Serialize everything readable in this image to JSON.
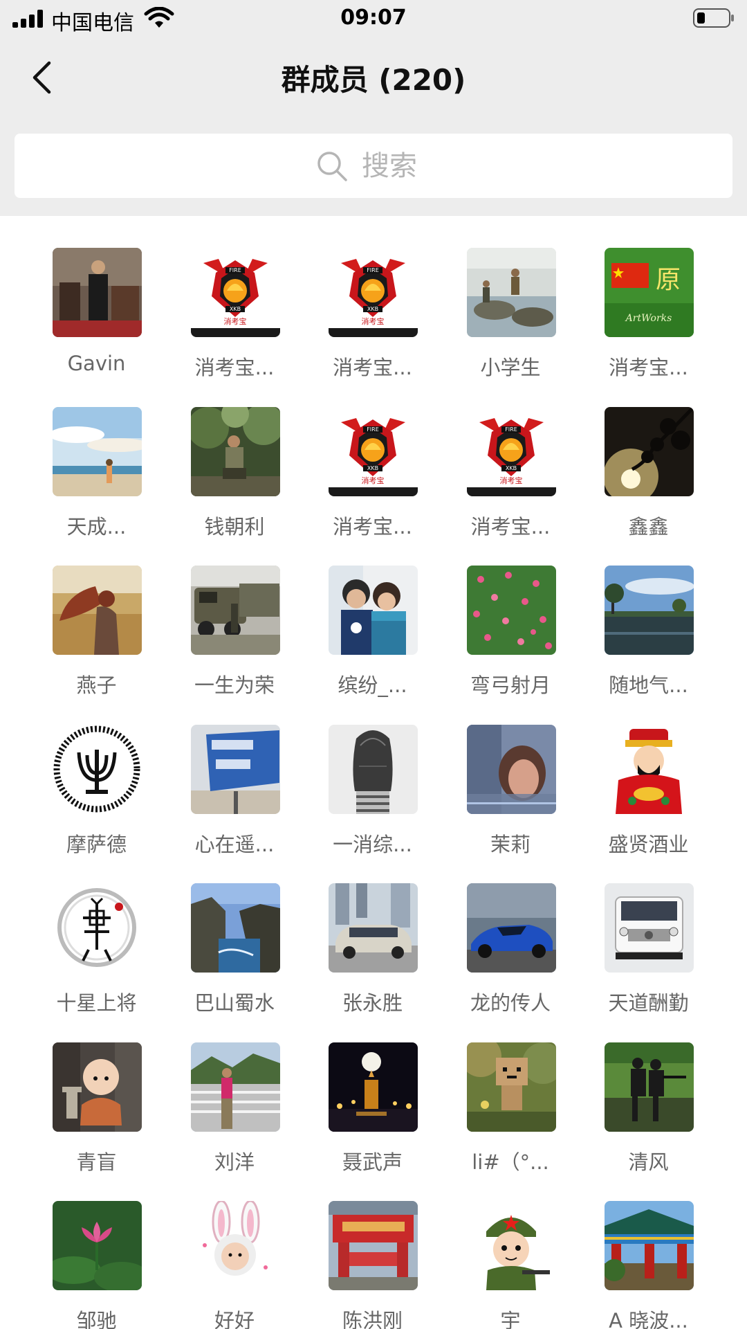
{
  "status_bar": {
    "carrier": "中国电信",
    "time": "09:07"
  },
  "header": {
    "back_icon": "chevron-left-icon",
    "title": "群成员 (220)"
  },
  "search": {
    "icon": "search-icon",
    "placeholder": "搜索"
  },
  "members": [
    {
      "name": "Gavin",
      "avatar": "photo-man-dark"
    },
    {
      "name": "消考宝...",
      "avatar": "fire-xkb-logo"
    },
    {
      "name": "消考宝...",
      "avatar": "fire-xkb-logo"
    },
    {
      "name": "小学生",
      "avatar": "photo-river-rocks"
    },
    {
      "name": "消考宝...",
      "avatar": "flag-grass"
    },
    {
      "name": "天成...",
      "avatar": "photo-beach-sky"
    },
    {
      "name": "钱朝利",
      "avatar": "photo-forest-man"
    },
    {
      "name": "消考宝...",
      "avatar": "fire-xkb-logo"
    },
    {
      "name": "消考宝...",
      "avatar": "fire-xkb-logo"
    },
    {
      "name": "鑫鑫",
      "avatar": "photo-silhouette-branch"
    },
    {
      "name": "燕子",
      "avatar": "photo-wheat-girl"
    },
    {
      "name": "一生为荣",
      "avatar": "photo-military-vehicle"
    },
    {
      "name": "缤纷_...",
      "avatar": "photo-couple"
    },
    {
      "name": "弯弓射月",
      "avatar": "photo-pink-flowers"
    },
    {
      "name": "随地气...",
      "avatar": "photo-lake-trees"
    },
    {
      "name": "摩萨德",
      "avatar": "emblem-menorah"
    },
    {
      "name": "心在遥...",
      "avatar": "photo-road-sign"
    },
    {
      "name": "一消综...",
      "avatar": "sketch-girl"
    },
    {
      "name": "茉莉",
      "avatar": "photo-blurred-woman"
    },
    {
      "name": "盛贤酒业",
      "avatar": "cartoon-fortune-god"
    },
    {
      "name": "十星上将",
      "avatar": "ink-tribal-figure"
    },
    {
      "name": "巴山蜀水",
      "avatar": "photo-coast-cliffs"
    },
    {
      "name": "张永胜",
      "avatar": "photo-silver-car"
    },
    {
      "name": "龙的传人",
      "avatar": "photo-blue-sportscar"
    },
    {
      "name": "天道酬勤",
      "avatar": "photo-white-suv"
    },
    {
      "name": "青盲",
      "avatar": "cartoon-monk"
    },
    {
      "name": "刘洋",
      "avatar": "photo-man-bridge"
    },
    {
      "name": "聂武声",
      "avatar": "photo-night-moon"
    },
    {
      "name": "li#（°...",
      "avatar": "photo-box-figure"
    },
    {
      "name": "清风",
      "avatar": "photo-soldiers"
    },
    {
      "name": "邹驰",
      "avatar": "photo-lotus"
    },
    {
      "name": "好好",
      "avatar": "photo-bunny-child"
    },
    {
      "name": "陈洪刚",
      "avatar": "photo-red-gate"
    },
    {
      "name": "宇",
      "avatar": "cartoon-soldier"
    },
    {
      "name": "A 晓波...",
      "avatar": "photo-pavilion"
    }
  ]
}
